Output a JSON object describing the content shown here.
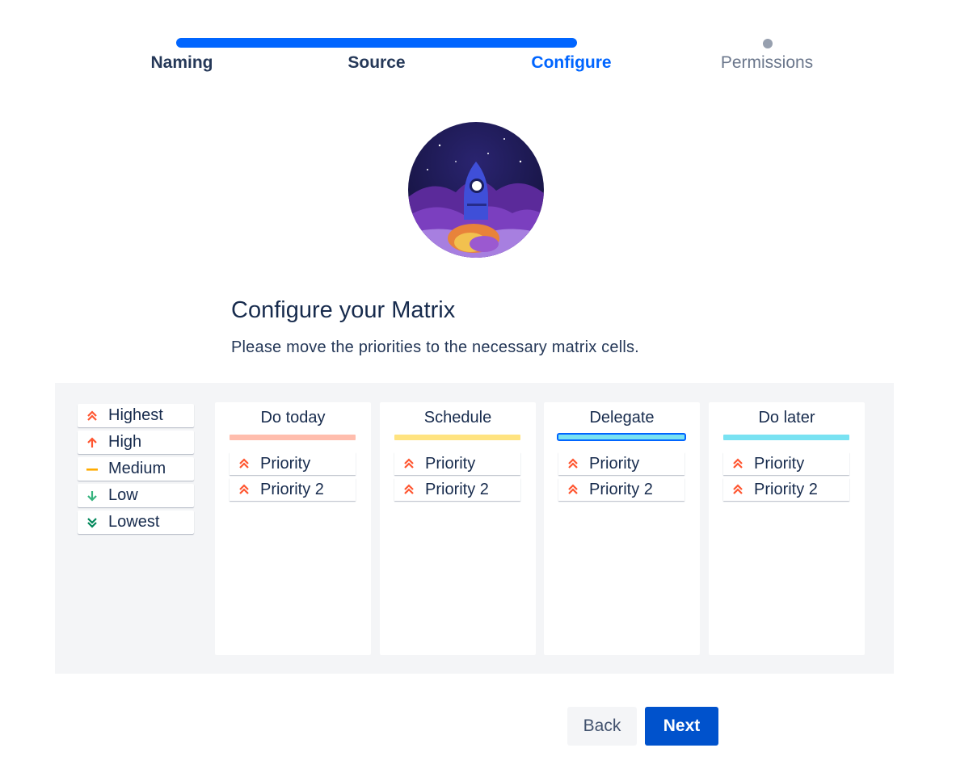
{
  "stepper": {
    "steps": [
      {
        "label": "Naming",
        "state": "done"
      },
      {
        "label": "Source",
        "state": "done"
      },
      {
        "label": "Configure",
        "state": "current"
      },
      {
        "label": "Permissions",
        "state": "todo"
      }
    ],
    "colors": {
      "progress": "#0065ff",
      "current": "#0065ff",
      "todo": "#97a0af"
    }
  },
  "illustration": {
    "icon": "rocket-illustration"
  },
  "content": {
    "title": "Configure your Matrix",
    "subtitle": "Please move the priorities to the necessary matrix cells."
  },
  "priorities": [
    {
      "label": "Highest",
      "icon": "highest-priority-icon",
      "color": "#ff5630"
    },
    {
      "label": "High",
      "icon": "high-priority-icon",
      "color": "#ff5630"
    },
    {
      "label": "Medium",
      "icon": "medium-priority-icon",
      "color": "#ffab00"
    },
    {
      "label": "Low",
      "icon": "low-priority-icon",
      "color": "#36b37e"
    },
    {
      "label": "Lowest",
      "icon": "lowest-priority-icon",
      "color": "#00875a"
    }
  ],
  "cells": [
    {
      "title": "Do today",
      "bar_color": "#ffbdad",
      "items": [
        "Priority",
        "Priority 2"
      ]
    },
    {
      "title": "Schedule",
      "bar_color": "#ffe380",
      "items": [
        "Priority",
        "Priority 2"
      ]
    },
    {
      "title": "Delegate",
      "bar_color": "#79e2f2",
      "selected": true,
      "items": [
        "Priority",
        "Priority 2"
      ]
    },
    {
      "title": "Do later",
      "bar_color": "#79e2f2",
      "items": [
        "Priority",
        "Priority 2"
      ]
    }
  ],
  "actions": {
    "back_label": "Back",
    "next_label": "Next"
  }
}
